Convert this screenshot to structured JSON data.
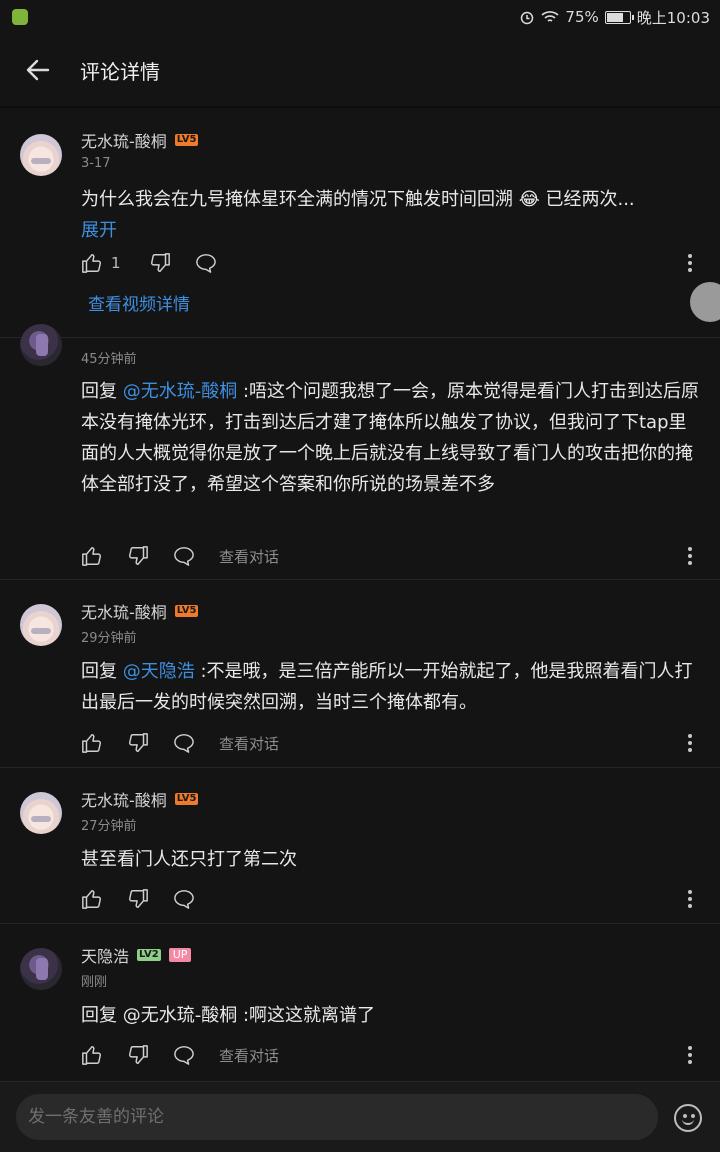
{
  "status_bar": {
    "battery": "75%",
    "time": "晚上10:03"
  },
  "header": {
    "title": "评论详情"
  },
  "main_comment": {
    "username": "无水琉-酸桐",
    "level": "LV5",
    "date": "3-17",
    "text": "为什么我会在九号掩体星环全满的情况下触发时间回溯 😂 已经两次...",
    "expand_label": "展开",
    "like_count": "1",
    "view_video_label": "查看视频详情"
  },
  "replies": [
    {
      "time": "45分钟前",
      "prefix": "回复 ",
      "mention": "@无水琉-酸桐",
      "text": " :唔这个问题我想了一会，原本觉得是看门人打击到达后原本没有掩体光环，打击到达后才建了掩体所以触发了协议，但我问了下tap里面的人大概觉得你是放了一个晚上后就没有上线导致了看门人的攻击把你的掩体全部打没了，希望这个答案和你所说的场景差不多",
      "convo_label": "查看对话"
    },
    {
      "username": "无水琉-酸桐",
      "level": "LV5",
      "time": "29分钟前",
      "prefix": "回复 ",
      "mention": "@天隐浩",
      "text": " :不是哦，是三倍产能所以一开始就起了，他是我照着看门人打出最后一发的时候突然回溯，当时三个掩体都有。",
      "convo_label": "查看对话"
    },
    {
      "username": "无水琉-酸桐",
      "level": "LV5",
      "time": "27分钟前",
      "text": "甚至看门人还只打了第二次"
    },
    {
      "username": "天隐浩",
      "level": "LV2",
      "badge": "UP",
      "time": "刚刚",
      "text": "回复 @无水琉-酸桐 :啊这这就离谱了",
      "convo_label": "查看对话"
    }
  ],
  "composer": {
    "placeholder": "发一条友善的评论"
  }
}
